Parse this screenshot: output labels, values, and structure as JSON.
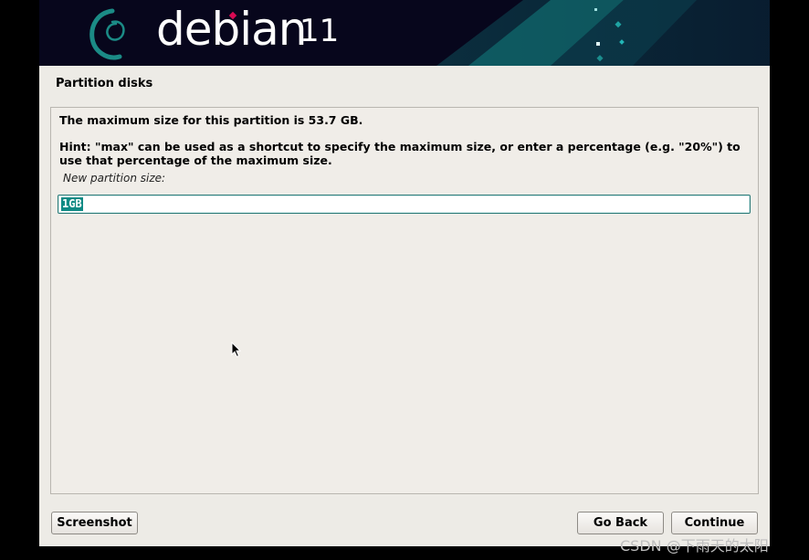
{
  "banner": {
    "logo_text": "debian",
    "version": "11"
  },
  "dialog": {
    "title": "Partition disks",
    "message_max_size": "The maximum size for this partition is 53.7 GB.",
    "message_hint": "Hint: \"max\" can be used as a shortcut to specify the maximum size, or enter a percentage (e.g. \"20%\") to use that percentage of the maximum size.",
    "field_label": "New partition size:",
    "field_value": "1GB"
  },
  "buttons": {
    "screenshot": "Screenshot",
    "go_back": "Go Back",
    "continue": "Continue"
  },
  "watermark": "CSDN @下雨天的太阳",
  "colors": {
    "banner_bg": "#07061c",
    "accent_teal": "#0f8a84",
    "window_bg": "#edebe6",
    "debian_red": "#d70a53"
  },
  "icons": {
    "logo": "debian-swirl-icon",
    "pointer": "mouse-pointer-icon"
  }
}
